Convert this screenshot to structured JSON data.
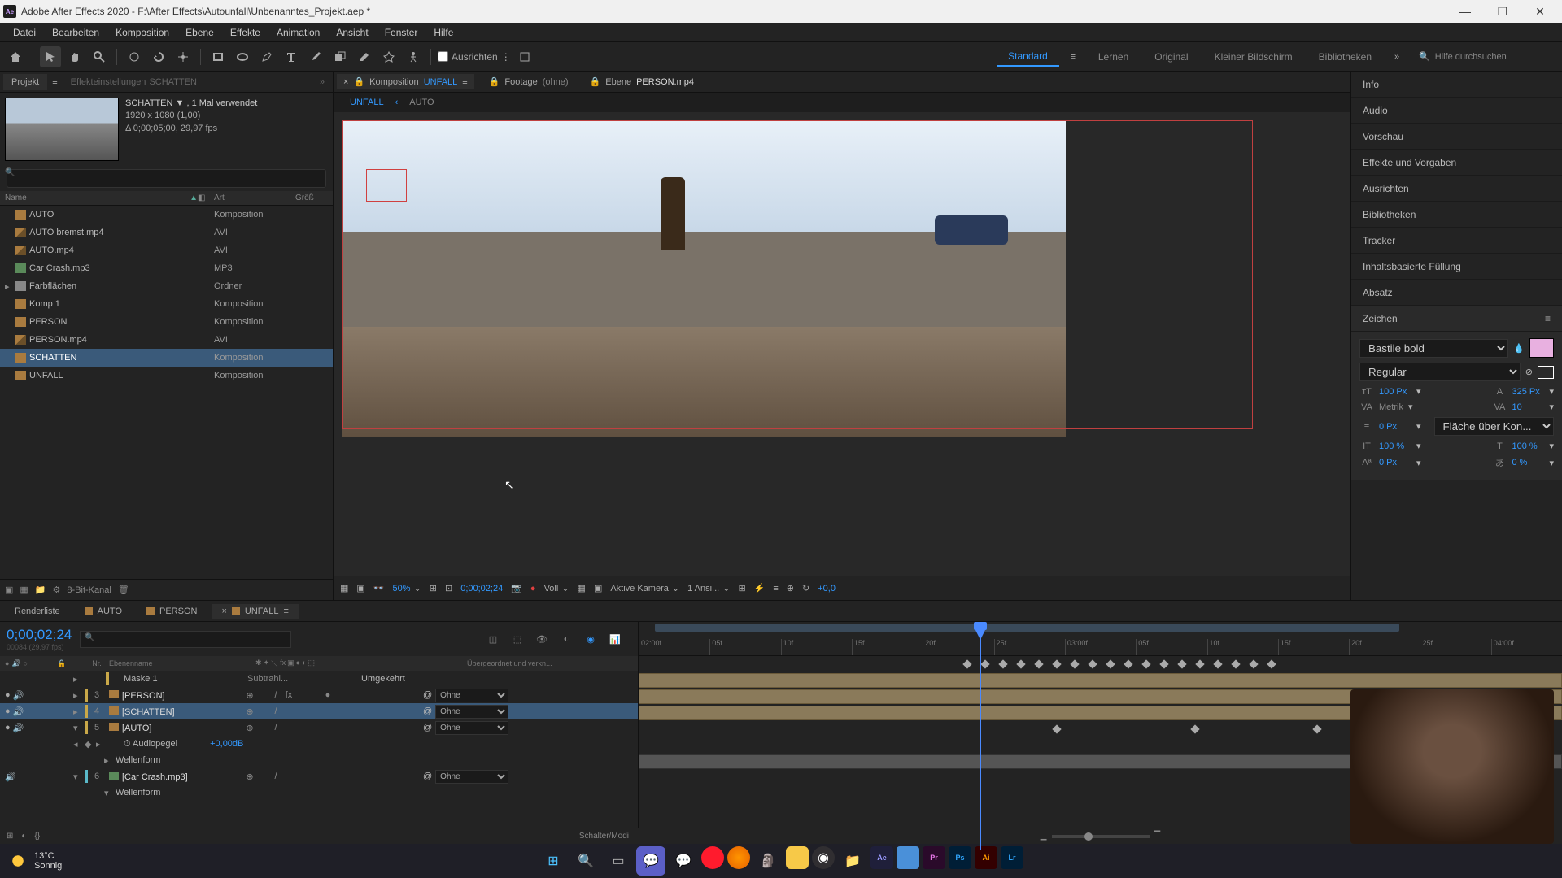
{
  "window": {
    "title": "Adobe After Effects 2020 - F:\\After Effects\\Autounfall\\Unbenanntes_Projekt.aep *"
  },
  "menu": [
    "Datei",
    "Bearbeiten",
    "Komposition",
    "Ebene",
    "Effekte",
    "Animation",
    "Ansicht",
    "Fenster",
    "Hilfe"
  ],
  "toolbar": {
    "ausrichten": "Ausrichten",
    "workspaces": [
      "Standard",
      "Lernen",
      "Original",
      "Kleiner Bildschirm",
      "Bibliotheken"
    ],
    "active_workspace": "Standard",
    "search_placeholder": "Hilfe durchsuchen"
  },
  "project_panel": {
    "tab": "Projekt",
    "effect_settings_label": "Effekteinstellungen",
    "effect_settings_target": "SCHATTEN",
    "selected": {
      "name": "SCHATTEN",
      "usage": ", 1 Mal verwendet",
      "dims": "1920 x 1080 (1,00)",
      "duration": "Δ 0;00;05;00, 29,97 fps"
    },
    "columns": {
      "name": "Name",
      "art": "Art",
      "gross": "Größ"
    },
    "items": [
      {
        "name": "AUTO",
        "art": "Komposition",
        "type": "comp",
        "tag": "yellow"
      },
      {
        "name": "AUTO bremst.mp4",
        "art": "AVI",
        "type": "video",
        "tag": "grey"
      },
      {
        "name": "AUTO.mp4",
        "art": "AVI",
        "type": "video",
        "tag": "grey"
      },
      {
        "name": "Car Crash.mp3",
        "art": "MP3",
        "type": "audio",
        "tag": "grey"
      },
      {
        "name": "Farbflächen",
        "art": "Ordner",
        "type": "folder",
        "tag": "yellow",
        "twirl": true
      },
      {
        "name": "Komp 1",
        "art": "Komposition",
        "type": "comp",
        "tag": "yellow"
      },
      {
        "name": "PERSON",
        "art": "Komposition",
        "type": "comp",
        "tag": "yellow"
      },
      {
        "name": "PERSON.mp4",
        "art": "AVI",
        "type": "video",
        "tag": "grey"
      },
      {
        "name": "SCHATTEN",
        "art": "Komposition",
        "type": "comp",
        "tag": "yellow",
        "selected": true
      },
      {
        "name": "UNFALL",
        "art": "Komposition",
        "type": "comp",
        "tag": "yellow"
      }
    ],
    "footer_bpc": "8-Bit-Kanal"
  },
  "comp_viewer": {
    "tabs": [
      {
        "label": "Komposition",
        "value": "UNFALL",
        "active": true
      },
      {
        "label": "Footage",
        "value": "(ohne)",
        "none": true
      },
      {
        "label": "Ebene",
        "value": "PERSON.mp4",
        "white": true
      }
    ],
    "breadcrumb": [
      "UNFALL",
      "AUTO"
    ],
    "footer": {
      "zoom": "50%",
      "timecode": "0;00;02;24",
      "resolution": "Voll",
      "camera": "Aktive Kamera",
      "views": "1 Ansi...",
      "exposure": "+0,0"
    }
  },
  "right_panels": {
    "items": [
      "Info",
      "Audio",
      "Vorschau",
      "Effekte und Vorgaben",
      "Ausrichten",
      "Bibliotheken",
      "Tracker",
      "Inhaltsbasierte Füllung",
      "Absatz",
      "Zeichen"
    ],
    "zeichen": {
      "font": "Bastile bold",
      "style": "Regular",
      "size": "100 Px",
      "leading": "325 Px",
      "kerning": "Metrik",
      "tracking": "10",
      "stroke": "0 Px",
      "stroke_mode": "Fläche über Kon...",
      "vscale": "100 %",
      "hscale": "100 %",
      "baseline": "0 Px",
      "tsume": "0 %"
    }
  },
  "timeline": {
    "tabs": [
      {
        "name": "Renderliste",
        "icon": false
      },
      {
        "name": "AUTO",
        "icon": true
      },
      {
        "name": "PERSON",
        "icon": true
      },
      {
        "name": "UNFALL",
        "icon": true,
        "active": true
      }
    ],
    "timecode": "0;00;02;24",
    "frames": "00084 (29,97 fps)",
    "col_headers": {
      "nr": "Nr.",
      "name": "Ebenenname",
      "parent": "Übergeordnet und verkn..."
    },
    "mask_row": {
      "name": "Maske 1",
      "mode": "Subtrahi...",
      "inverted": "Umgekehrt"
    },
    "layers": [
      {
        "num": "3",
        "name": "[PERSON]",
        "color": "yellow",
        "parent": "Ohne",
        "fx": true
      },
      {
        "num": "4",
        "name": "[SCHATTEN]",
        "color": "yellow",
        "parent": "Ohne",
        "selected": true
      },
      {
        "num": "5",
        "name": "[AUTO]",
        "color": "yellow",
        "parent": "Ohne",
        "expanded": true
      },
      {
        "num": "6",
        "name": "[Car Crash.mp3]",
        "color": "cyan",
        "parent": "Ohne",
        "audio_only": true
      }
    ],
    "audio_props": {
      "audiopegel": "Audiopegel",
      "audiopegel_val": "+0,00dB",
      "wellenform": "Wellenform"
    },
    "ruler_ticks": [
      "02:00f",
      "05f",
      "10f",
      "15f",
      "20f",
      "25f",
      "03:00f",
      "05f",
      "10f",
      "15f",
      "20f",
      "25f",
      "04:00f"
    ],
    "footer_label": "Schalter/Modi"
  },
  "taskbar": {
    "temp": "13°C",
    "weather": "Sonnig"
  }
}
